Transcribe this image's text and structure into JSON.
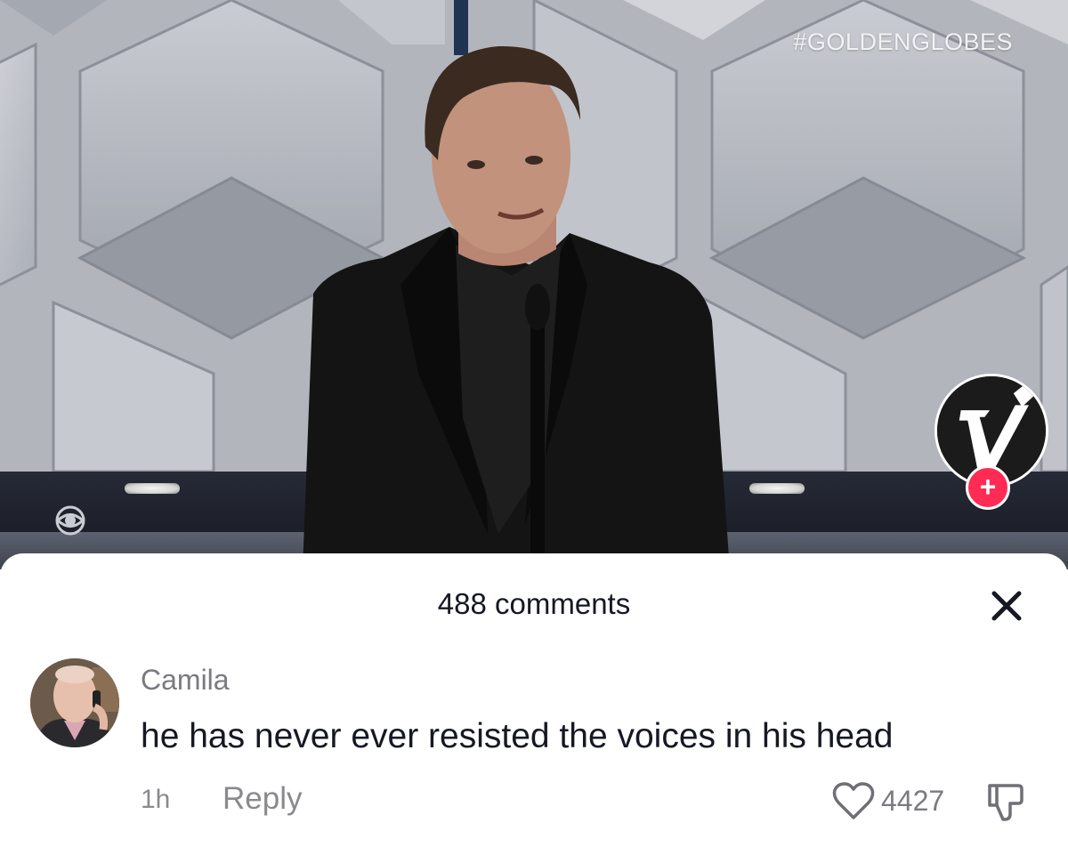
{
  "video": {
    "hashtag": "#GOLDENGLOBES",
    "network_logo_icon": "cbs-eye-icon",
    "creator_avatar_icon": "v-logo-icon",
    "follow_icon": "plus-icon",
    "follow_label": "+"
  },
  "comments_panel": {
    "title": "488 comments",
    "close_icon": "close-icon"
  },
  "comments": [
    {
      "username": "Camila",
      "text": "he has never ever resisted the voices in his head",
      "time": "1h",
      "reply_label": "Reply",
      "like_count": "4427",
      "like_icon": "heart-outline-icon",
      "dislike_icon": "thumbs-down-icon"
    }
  ],
  "colors": {
    "accent": "#fe2c55",
    "text_primary": "#161823",
    "text_secondary": "#8a8a8e"
  }
}
